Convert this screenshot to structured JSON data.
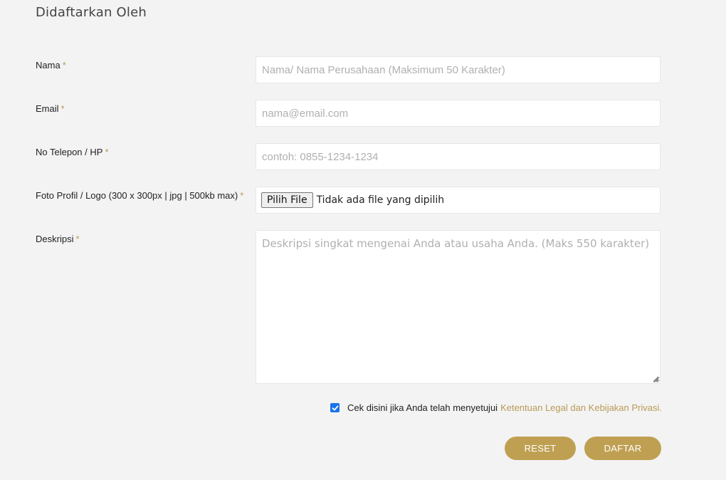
{
  "section_title": "Didaftarkan Oleh",
  "required_mark": "*",
  "fields": {
    "nama": {
      "label": "Nama",
      "placeholder": "Nama/ Nama Perusahaan (Maksimum 50 Karakter)"
    },
    "email": {
      "label": "Email",
      "placeholder": "nama@email.com"
    },
    "phone": {
      "label": "No Telepon / HP",
      "placeholder": "contoh: 0855-1234-1234"
    },
    "photo": {
      "label": "Foto Profil / Logo (300 x 300px | jpg | 500kb max)",
      "button_label": "Pilih File",
      "status": "Tidak ada file yang dipilih"
    },
    "description": {
      "label": "Deskripsi",
      "placeholder": "Deskripsi singkat mengenai Anda atau usaha Anda. (Maks 550 karakter)"
    }
  },
  "agreement": {
    "checked": true,
    "text": "Cek disini jika Anda telah menyetujui",
    "link_text": "Ketentuan Legal dan Kebijakan Privasi."
  },
  "buttons": {
    "reset_label": "RESET",
    "submit_label": "DAFTAR"
  },
  "colors": {
    "background": "#f3f3f3",
    "accent": "#bfa052",
    "required_mark": "#b89a57",
    "checkbox": "#1a73e8"
  }
}
